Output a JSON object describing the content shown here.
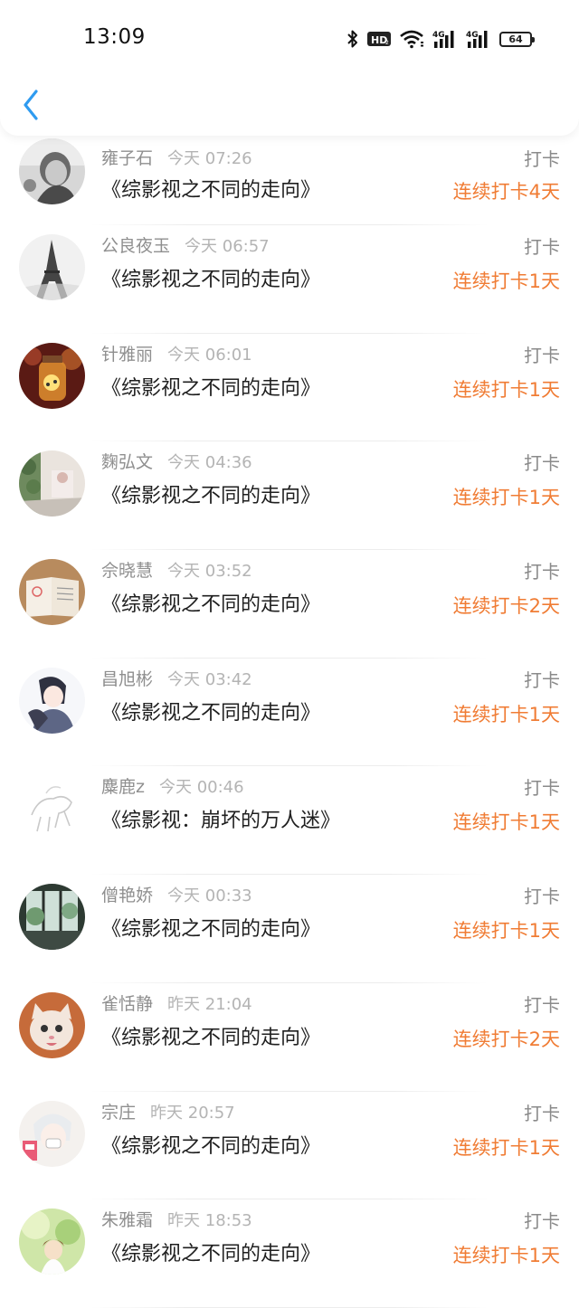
{
  "status_bar": {
    "time": "13:09",
    "battery": "64",
    "icons": [
      "bluetooth-icon",
      "hd-icon",
      "wifi-icon",
      "signal-4g-icon",
      "signal-4g-icon",
      "battery-icon"
    ]
  },
  "header": {
    "back_icon": "chevron-left-icon"
  },
  "colors": {
    "accent_orange": "#f07c34",
    "back_blue": "#2f9bf0",
    "name_gray": "#8f8f8f",
    "time_gray": "#b4b4b4",
    "title_black": "#1f1f1f"
  },
  "list": {
    "items": [
      {
        "name": "雍子石",
        "time": "今天 07:26",
        "book": "《综影视之不同的走向》",
        "action": "打卡",
        "streak": "连续打卡4天",
        "avatar": "avatar-child-bw"
      },
      {
        "name": "公良夜玉",
        "time": "今天 06:57",
        "book": "《综影视之不同的走向》",
        "action": "打卡",
        "streak": "连续打卡1天",
        "avatar": "avatar-eiffel-tower"
      },
      {
        "name": "针雅丽",
        "time": "今天 06:01",
        "book": "《综影视之不同的走向》",
        "action": "打卡",
        "streak": "连续打卡1天",
        "avatar": "avatar-jar-lights"
      },
      {
        "name": "麴弘文",
        "time": "今天 04:36",
        "book": "《综影视之不同的走向》",
        "action": "打卡",
        "streak": "连续打卡1天",
        "avatar": "avatar-room-plants"
      },
      {
        "name": "佘晓慧",
        "time": "今天 03:52",
        "book": "《综影视之不同的走向》",
        "action": "打卡",
        "streak": "连续打卡2天",
        "avatar": "avatar-open-book"
      },
      {
        "name": "昌旭彬",
        "time": "今天 03:42",
        "book": "《综影视之不同的走向》",
        "action": "打卡",
        "streak": "连续打卡1天",
        "avatar": "avatar-anime-couple"
      },
      {
        "name": "麋鹿z",
        "time": "今天 00:46",
        "book": "《综影视：崩坏的万人迷》",
        "action": "打卡",
        "streak": "连续打卡1天",
        "avatar": "avatar-sketch-horse"
      },
      {
        "name": "僧艳娇",
        "time": "今天 00:33",
        "book": "《综影视之不同的走向》",
        "action": "打卡",
        "streak": "连续打卡1天",
        "avatar": "avatar-window-view"
      },
      {
        "name": "雀恬静",
        "time": "昨天 21:04",
        "book": "《综影视之不同的走向》",
        "action": "打卡",
        "streak": "连续打卡2天",
        "avatar": "avatar-kitten"
      },
      {
        "name": "宗庄",
        "time": "昨天 20:57",
        "book": "《综影视之不同的走向》",
        "action": "打卡",
        "streak": "连续打卡1天",
        "avatar": "avatar-anime-boy"
      },
      {
        "name": "朱雅霜",
        "time": "昨天 18:53",
        "book": "《综影视之不同的走向》",
        "action": "打卡",
        "streak": "连续打卡1天",
        "avatar": "avatar-green-girl"
      }
    ]
  }
}
